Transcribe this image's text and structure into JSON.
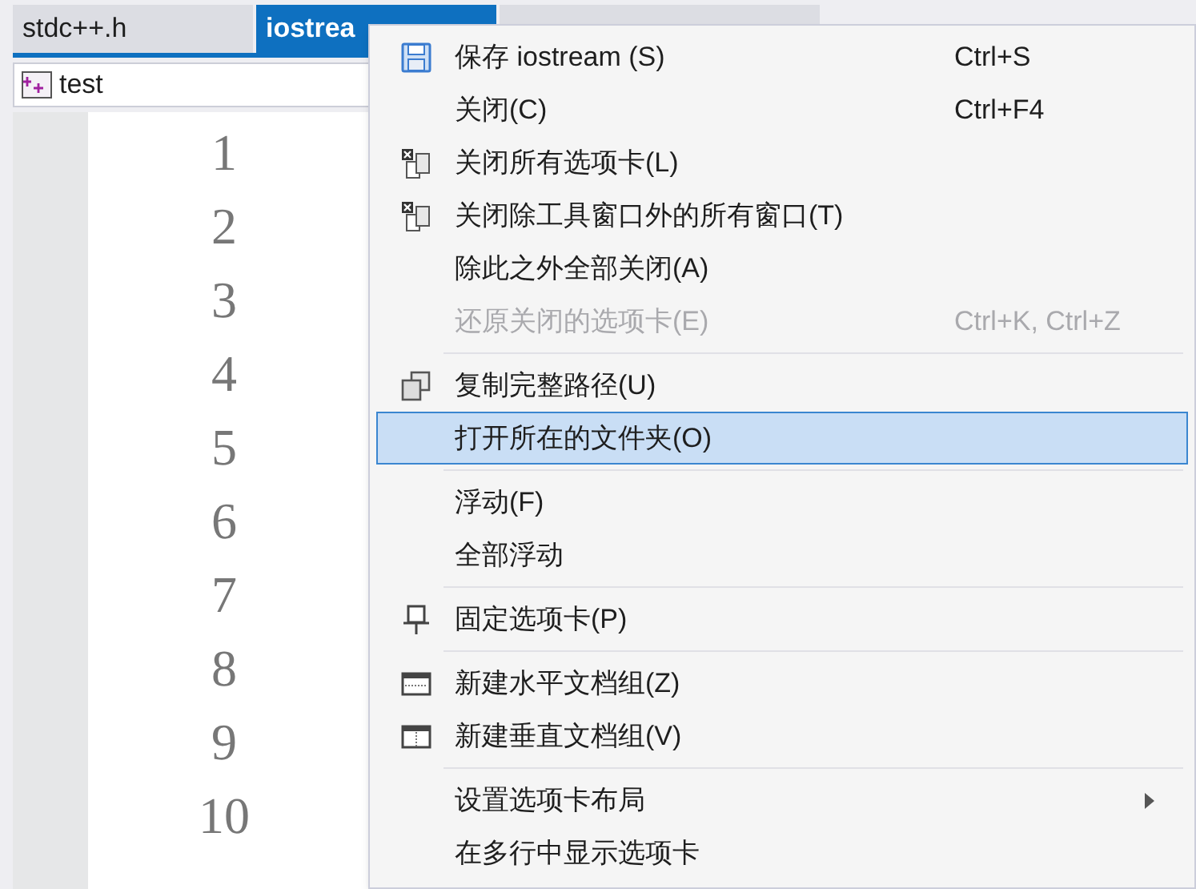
{
  "tabs": [
    {
      "label": "stdc++.h",
      "selected": false
    },
    {
      "label": "iostrea",
      "selected": true
    },
    {
      "selected": false
    }
  ],
  "navigation_bar": {
    "project": "test"
  },
  "line_numbers": [
    "1",
    "2",
    "3",
    "4",
    "5",
    "6",
    "7",
    "8",
    "9",
    "10"
  ],
  "context_menu": {
    "items": [
      {
        "kind": "item",
        "label": "保存 iostream (S)",
        "shortcut": "Ctrl+S",
        "disabled": false,
        "selected": false
      },
      {
        "kind": "item",
        "label": "关闭(C)",
        "shortcut": "Ctrl+F4",
        "disabled": false,
        "selected": false
      },
      {
        "kind": "item",
        "label": "关闭所有选项卡(L)",
        "disabled": false,
        "selected": false
      },
      {
        "kind": "item",
        "label": "关闭除工具窗口外的所有窗口(T)",
        "disabled": false,
        "selected": false
      },
      {
        "kind": "item",
        "label": "除此之外全部关闭(A)",
        "disabled": false,
        "selected": false
      },
      {
        "kind": "item",
        "label": "还原关闭的选项卡(E)",
        "shortcut": "Ctrl+K, Ctrl+Z",
        "disabled": true,
        "selected": false
      },
      {
        "kind": "separator"
      },
      {
        "kind": "item",
        "label": "复制完整路径(U)",
        "disabled": false,
        "selected": false
      },
      {
        "kind": "item",
        "label": "打开所在的文件夹(O)",
        "disabled": false,
        "selected": true
      },
      {
        "kind": "separator"
      },
      {
        "kind": "item",
        "label": "浮动(F)",
        "disabled": false,
        "selected": false
      },
      {
        "kind": "item",
        "label": "全部浮动",
        "disabled": false,
        "selected": false
      },
      {
        "kind": "separator"
      },
      {
        "kind": "item",
        "label": "固定选项卡(P)",
        "disabled": false,
        "selected": false
      },
      {
        "kind": "separator"
      },
      {
        "kind": "item",
        "label": "新建水平文档组(Z)",
        "disabled": false,
        "selected": false
      },
      {
        "kind": "item",
        "label": "新建垂直文档组(V)",
        "disabled": false,
        "selected": false
      },
      {
        "kind": "separator"
      },
      {
        "kind": "item",
        "label": "设置选项卡布局",
        "disabled": false,
        "selected": false,
        "submenu": true
      },
      {
        "kind": "item",
        "label": "在多行中显示选项卡",
        "disabled": false,
        "selected": false
      }
    ]
  }
}
